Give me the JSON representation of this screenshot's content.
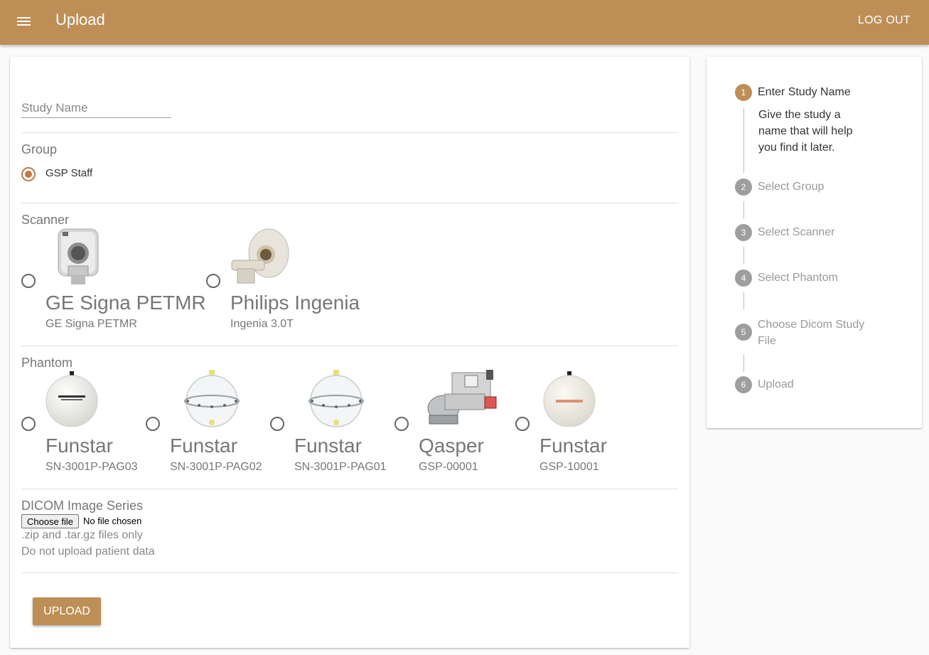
{
  "appbar": {
    "title": "Upload",
    "logout_label": "LOG OUT"
  },
  "form": {
    "study_name_placeholder": "Study Name",
    "group": {
      "label": "Group",
      "options": [
        {
          "name": "GSP Staff",
          "selected": true
        }
      ]
    },
    "scanner": {
      "label": "Scanner",
      "options": [
        {
          "title": "GE Signa PETMR",
          "subtitle": "GE Signa PETMR"
        },
        {
          "title": "Philips Ingenia",
          "subtitle": "Ingenia 3.0T"
        }
      ]
    },
    "phantom": {
      "label": "Phantom",
      "options": [
        {
          "title": "Funstar",
          "subtitle": "SN-3001P-PAG03"
        },
        {
          "title": "Funstar",
          "subtitle": "SN-3001P-PAG02"
        },
        {
          "title": "Funstar",
          "subtitle": "SN-3001P-PAG01"
        },
        {
          "title": "Qasper",
          "subtitle": "GSP-00001"
        },
        {
          "title": "Funstar",
          "subtitle": "GSP-10001"
        }
      ]
    },
    "dicom": {
      "label": "DICOM Image Series",
      "choose_file_label": "Choose file",
      "no_file_text": "No file chosen",
      "hint1": ".zip and .tar.gz files only",
      "hint2": "Do not upload patient data"
    },
    "upload_label": "UPLOAD"
  },
  "stepper": {
    "steps": [
      {
        "num": "1",
        "title": "Enter Study Name",
        "active": true,
        "description": "Give the study a name that will help you find it later."
      },
      {
        "num": "2",
        "title": "Select Group"
      },
      {
        "num": "3",
        "title": "Select Scanner"
      },
      {
        "num": "4",
        "title": "Select Phantom"
      },
      {
        "num": "5",
        "title": "Choose Dicom Study File"
      },
      {
        "num": "6",
        "title": "Upload"
      }
    ]
  },
  "colors": {
    "primary": "#bd8f56",
    "radio_accent": "#c07a45"
  }
}
